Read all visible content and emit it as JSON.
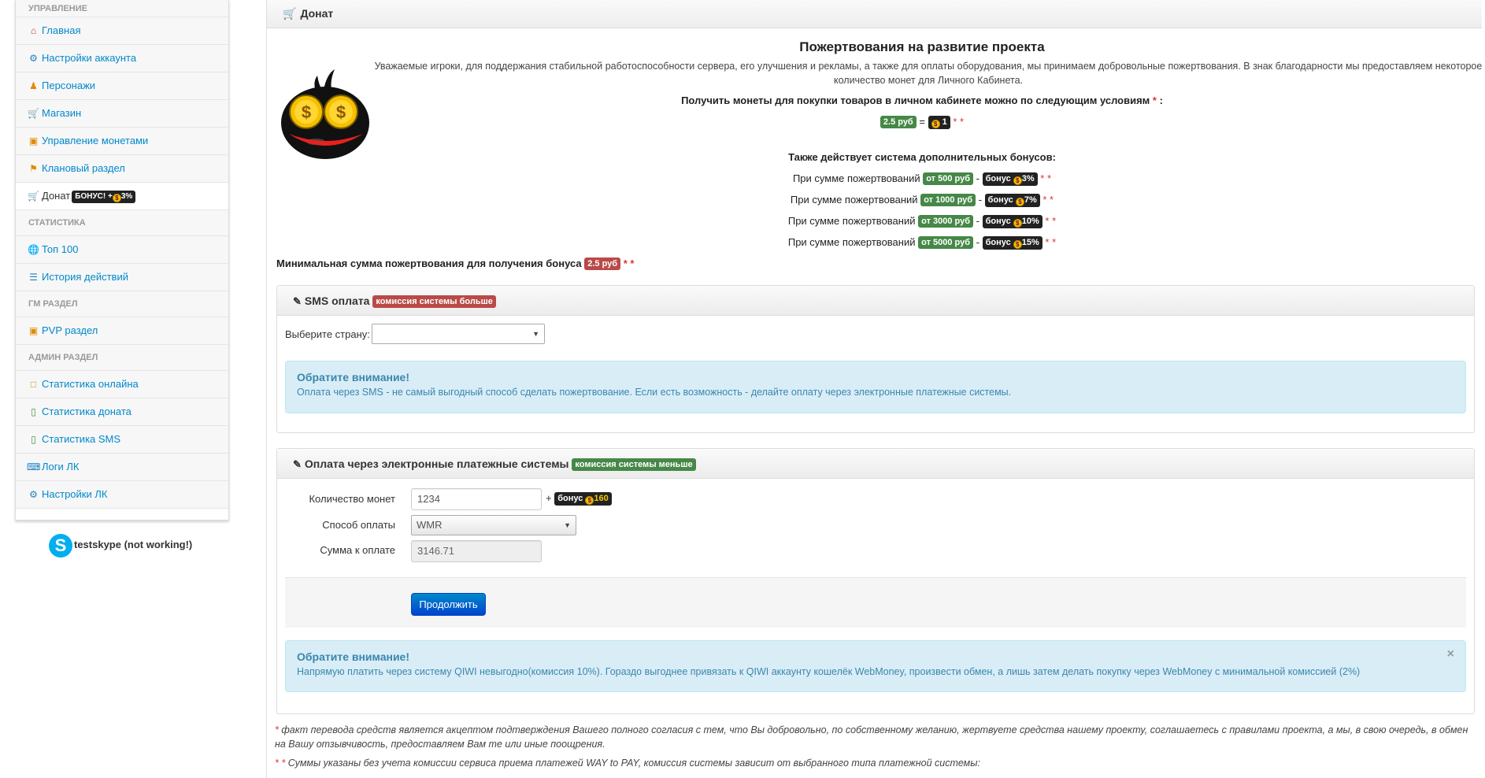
{
  "sidebar": {
    "sections": [
      {
        "header": "УПРАВЛЕНИЕ",
        "items": [
          {
            "label": "Главная",
            "icon": "home-icon"
          },
          {
            "label": "Настройки аккаунта",
            "icon": "gear-icon"
          },
          {
            "label": "Персонажи",
            "icon": "users-icon"
          },
          {
            "label": "Магазин",
            "icon": "cart-icon"
          },
          {
            "label": "Управление монетами",
            "icon": "coins-icon"
          },
          {
            "label": "Клановый раздел",
            "icon": "flag-icon"
          },
          {
            "label": "Донат",
            "icon": "basket-icon",
            "badge": "БОНУС! +",
            "badge_value": "3%"
          }
        ]
      },
      {
        "header": "СТАТИСТИКА",
        "items": [
          {
            "label": "Топ 100",
            "icon": "globe-icon"
          },
          {
            "label": "История действий",
            "icon": "list-icon"
          }
        ]
      },
      {
        "header": "ГМ РАЗДЕЛ",
        "items": [
          {
            "label": "PVP раздел",
            "icon": "pvp-icon"
          }
        ]
      },
      {
        "header": "АДМИН РАЗДЕЛ",
        "items": [
          {
            "label": "Статистика онлайна",
            "icon": "chat-icon"
          },
          {
            "label": "Статистика доната",
            "icon": "phone-icon"
          },
          {
            "label": "Статистика SMS",
            "icon": "phone-icon"
          },
          {
            "label": "Логи ЛК",
            "icon": "keyboard-icon"
          },
          {
            "label": "Настройки ЛК",
            "icon": "gear-icon"
          }
        ]
      }
    ],
    "skype": "testskype (not working!)"
  },
  "header": {
    "title": "Донат"
  },
  "promo": {
    "title": "Пожертвования на развитие проекта",
    "desc": "Уважаемые игроки, для поддержания стабильной работоспособности сервера, его улучшения и рекламы, а также для оплаты оборудования, мы принимаем добровольные пожертвования. В знак благодарности мы предоставляем некоторое количество монет для Личного Кабинета.",
    "conditions": "Получить монеты для покупки товаров в личном кабинете можно по следующим условиям",
    "rate_rub": "2.5 руб",
    "rate_coins": "1",
    "bonus_title": "Также действует система дополнительных бонусов:",
    "bonus_prefix": "При сумме пожертвований",
    "bonuses": [
      {
        "from": "от 500 руб",
        "bonus": "3%"
      },
      {
        "from": "от 1000 руб",
        "bonus": "7%"
      },
      {
        "from": "от 3000 руб",
        "bonus": "10%"
      },
      {
        "from": "от 5000 руб",
        "bonus": "15%"
      }
    ],
    "bonus_word": "бонус",
    "min_sum_text": "Минимальная сумма пожертвования для получения бонуса",
    "min_sum_value": "2.5 руб"
  },
  "sms": {
    "title": "SMS оплата",
    "badge": "комиссия системы больше",
    "country_label": "Выберите страну:",
    "country_value": "",
    "alert_title": "Обратите внимание!",
    "alert_text": "Оплата через SMS - не самый выгодный способ сделать пожертвование. Если есть возможность - делайте оплату через электронные платежные системы."
  },
  "epay": {
    "title": "Оплата через электронные платежные системы",
    "badge": "комиссия системы меньше",
    "coins_label": "Количество монет",
    "coins_value": "1234",
    "bonus_label": "бонус",
    "bonus_value": "160",
    "method_label": "Способ оплаты",
    "method_value": "WMR",
    "sum_label": "Сумма к оплате",
    "sum_value": "3146.71",
    "submit": "Продолжить",
    "alert_title": "Обратите внимание!",
    "alert_text": "Напрямую платить через систему QIWI невыгодно(комиссия 10%). Гораздо выгоднее привязать к QIWI аккаунту кошелёк WebMoney, произвести обмен, а лишь затем делать покупку через WebMoney с минимальной комиссией (2%)",
    "alert_close": "×"
  },
  "notes": {
    "n1": "факт перевода средств является акцептом подтверждения Вашего полного согласия с тем, что Вы добровольно, по собственному желанию, жертвуете средства нашему проекту, соглашаетесь с правилами проекта, а мы, в свою очередь, в обмен на Вашу отзывчивость, предоставляем Вам те или иные поощрения.",
    "n2": "Суммы указаны без учета комиссии сервиса приема платежей WAY to PAY, комиссия системы зависит от выбранного типа платежной системы:"
  }
}
